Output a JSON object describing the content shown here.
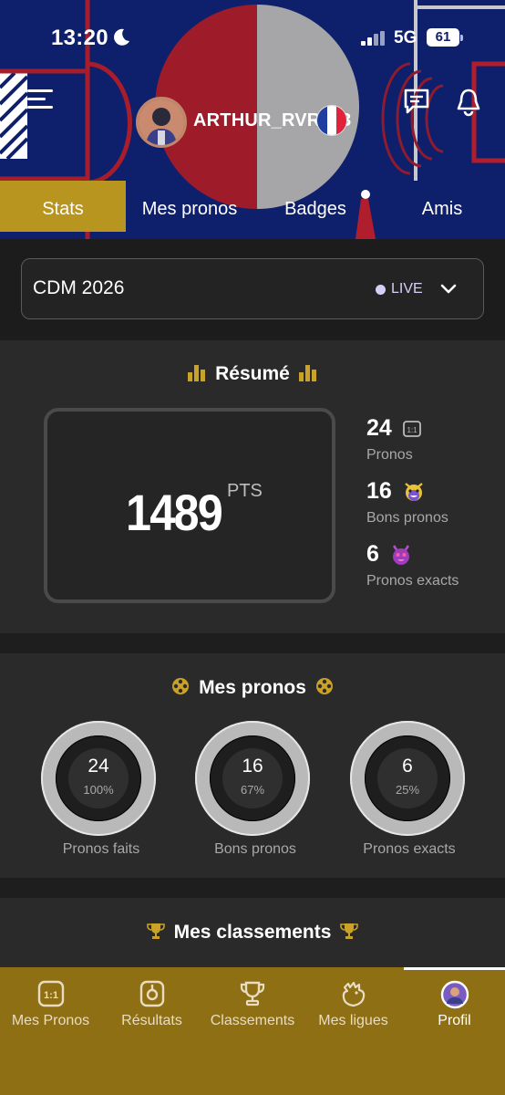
{
  "status_bar": {
    "time": "13:20",
    "network": "5G",
    "battery": "61"
  },
  "profile": {
    "username": "ARTHUR_RVR693",
    "country_flag": "france-flag"
  },
  "tabs": [
    {
      "label": "Stats",
      "active": true
    },
    {
      "label": "Mes pronos",
      "active": false
    },
    {
      "label": "Badges",
      "active": false
    },
    {
      "label": "Amis",
      "active": false
    }
  ],
  "competition": {
    "name": "CDM 2026",
    "status": "LIVE"
  },
  "resume": {
    "title": "Résumé",
    "points": "1489",
    "points_unit": "PTS",
    "stats": [
      {
        "value": "24",
        "label": "Pronos",
        "icon": "score-card-icon"
      },
      {
        "value": "16",
        "label": "Bons pronos",
        "icon": "happy-face-icon"
      },
      {
        "value": "6",
        "label": "Pronos exacts",
        "icon": "devil-face-icon"
      }
    ]
  },
  "mes_pronos": {
    "title": "Mes pronos",
    "rings": [
      {
        "value": "24",
        "percent": "100%",
        "label": "Pronos faits"
      },
      {
        "value": "16",
        "percent": "67%",
        "label": "Bons pronos"
      },
      {
        "value": "6",
        "percent": "25%",
        "label": "Pronos exacts"
      }
    ]
  },
  "classements": {
    "title": "Mes classements"
  },
  "bottom_nav": [
    {
      "label": "Mes Pronos",
      "icon": "score-card-icon"
    },
    {
      "label": "Résultats",
      "icon": "whistle-icon"
    },
    {
      "label": "Classements",
      "icon": "trophy-icon"
    },
    {
      "label": "Mes ligues",
      "icon": "rooster-icon"
    },
    {
      "label": "Profil",
      "icon": "avatar-icon",
      "active": true
    }
  ],
  "colors": {
    "header_bg": "#0e1f6b",
    "gold": "#b8951f",
    "nav_bg": "#8e6f13",
    "card_bg": "#2a2a2a",
    "live": "#d5cff5"
  }
}
